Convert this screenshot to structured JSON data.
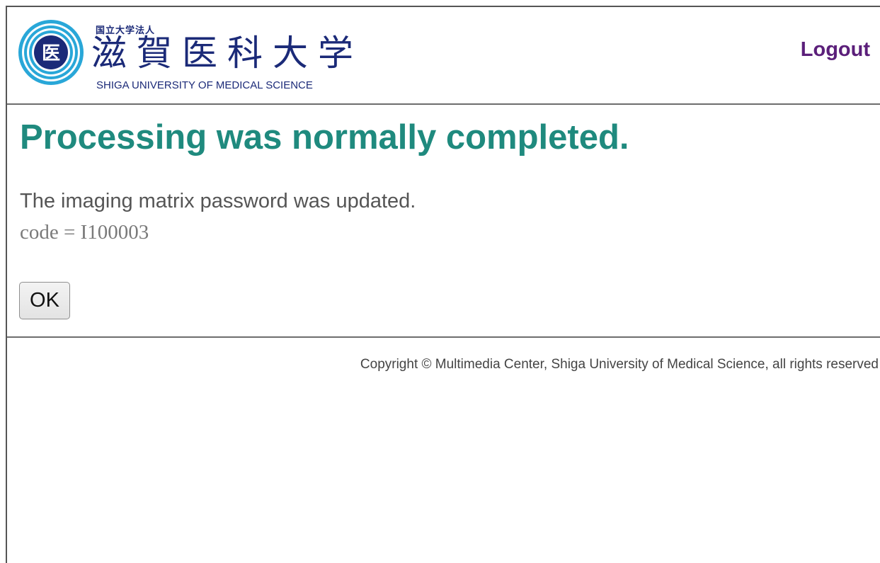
{
  "header": {
    "logo": {
      "small_text": "国立大学法人",
      "jp_name": "滋賀医科大学",
      "en_name": "SHIGA UNIVERSITY OF MEDICAL SCIENCE",
      "emblem_char": "医",
      "emblem_colors": [
        "#1b2a78",
        "#29a7d8"
      ]
    },
    "logout_label": "Logout"
  },
  "main": {
    "title": "Processing was normally completed.",
    "message": "The imaging matrix password was updated.",
    "code": "code = I100003",
    "ok_label": "OK"
  },
  "footer": {
    "copyright": "Copyright © Multimedia Center, Shiga University of Medical Science, all rights reserved"
  },
  "colors": {
    "title": "#1f8a7e",
    "logout": "#5b1f7a",
    "brand": "#1b2a78"
  }
}
